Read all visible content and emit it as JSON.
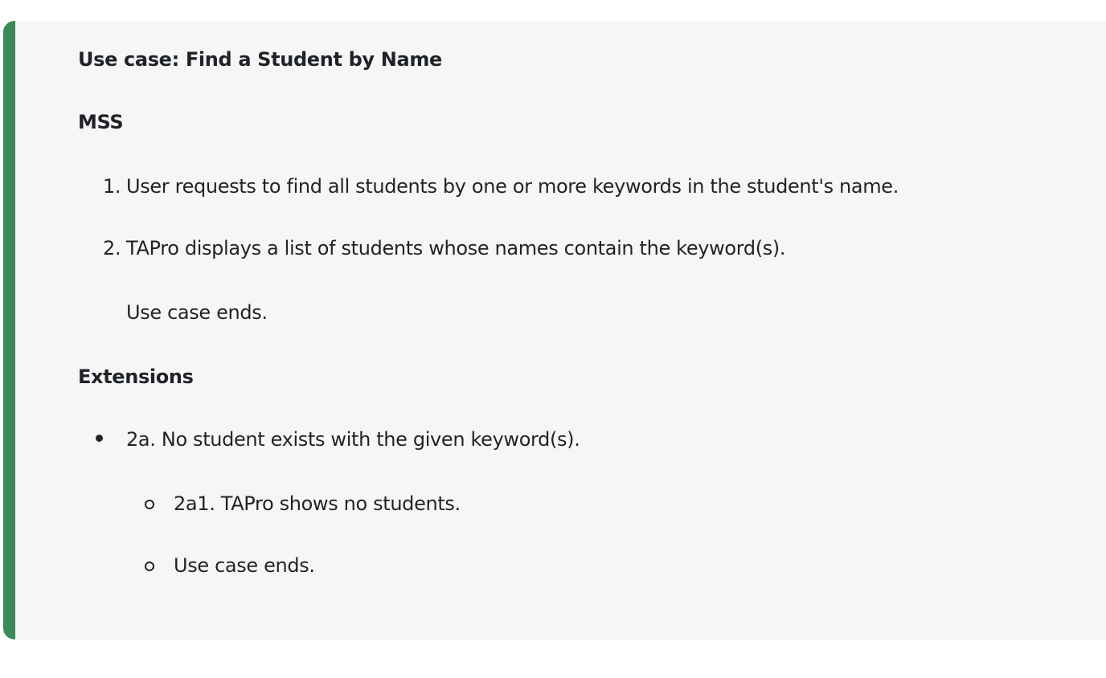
{
  "use_case": {
    "title": "Use case: Find a Student by Name",
    "mss_heading": "MSS",
    "mss_steps": [
      {
        "number": "1.",
        "text": "User requests to find all students by one or more keywords in the student's name."
      },
      {
        "number": "2.",
        "text": "TAPro displays a list of students whose names contain the keyword(s)."
      }
    ],
    "mss_end": "Use case ends.",
    "extensions_heading": "Extensions",
    "extensions": [
      {
        "text": "2a. No student exists with the given keyword(s).",
        "sub_items": [
          "2a1. TAPro shows no students.",
          "Use case ends."
        ]
      }
    ]
  },
  "colors": {
    "accent_border": "#3a8a5a",
    "card_background": "#f6f6f6",
    "text": "#1f2328"
  }
}
